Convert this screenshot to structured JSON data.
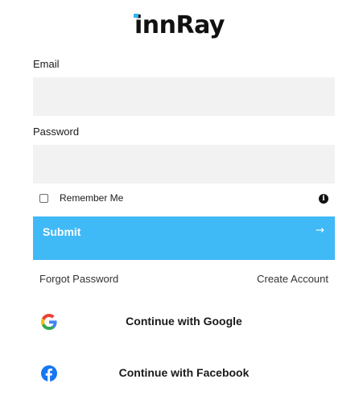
{
  "brand": {
    "logo_text": "innRay",
    "accent_color": "#34b4f0"
  },
  "form": {
    "email_label": "Email",
    "email_value": "",
    "email_placeholder": "",
    "password_label": "Password",
    "password_value": "",
    "password_placeholder": "",
    "remember_label": "Remember Me",
    "remember_checked": false,
    "submit_label": "Submit",
    "submit_color": "#40b9f7"
  },
  "links": {
    "forgot_password": "Forgot Password",
    "create_account": "Create Account"
  },
  "social": {
    "google_label": "Continue with Google",
    "facebook_label": "Continue with Facebook"
  },
  "icons": {
    "info": "info-icon",
    "submit_arrow": "arrow-right-icon",
    "google": "google-icon",
    "facebook": "facebook-icon"
  }
}
